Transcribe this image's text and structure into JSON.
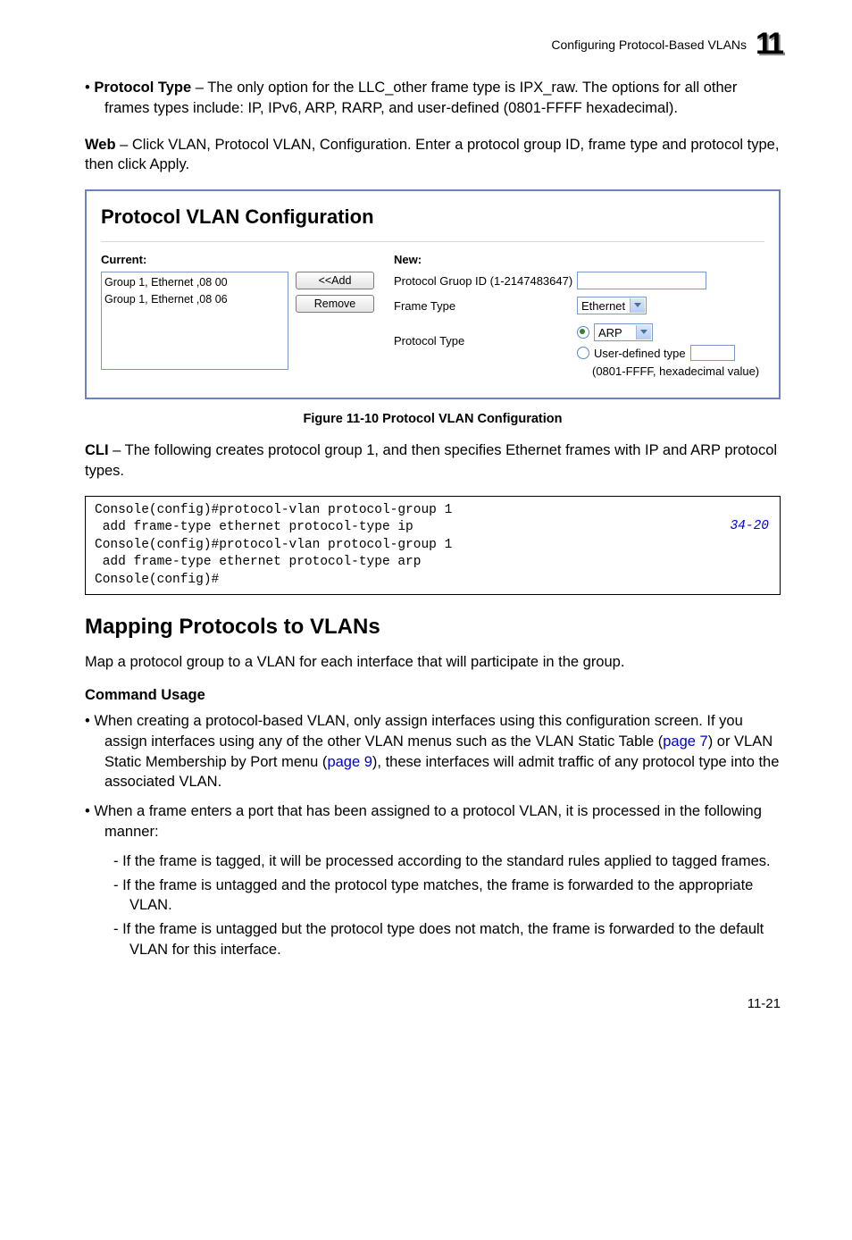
{
  "header": {
    "breadcrumb": "Configuring Protocol-Based VLANs",
    "chapter": "11"
  },
  "intro_bullet": {
    "label": "Protocol Type",
    "text": " – The only option for the LLC_other frame type is IPX_raw. The options for all other frames types include: IP, IPv6, ARP, RARP, and user-defined (0801-FFFF hexadecimal)."
  },
  "web_para": {
    "lead": "Web",
    "text": " – Click VLAN, Protocol VLAN, Configuration. Enter a protocol group ID, frame type and protocol type, then click Apply."
  },
  "shot": {
    "title": "Protocol VLAN Configuration",
    "current_label": "Current:",
    "new_label": "New:",
    "list_items": [
      "Group 1, Ethernet ,08 00",
      "Group 1, Ethernet ,08 06"
    ],
    "add_btn": "<<Add",
    "remove_btn": "Remove",
    "fields": {
      "group_id": "Protocol Gruop ID (1-2147483647)",
      "frame_type": "Frame Type",
      "frame_type_value": "Ethernet",
      "protocol_type": "Protocol Type",
      "proto_opt1": "ARP",
      "proto_opt2_a": "User-defined type",
      "proto_opt2_b": "(0801-FFFF, hexadecimal value)"
    }
  },
  "figure_caption": "Figure 11-10   Protocol VLAN Configuration",
  "cli_para": {
    "lead": "CLI",
    "text": " – The following creates protocol group 1, and then specifies Ethernet frames with IP and ARP protocol types."
  },
  "code": {
    "lines": "Console(config)#protocol-vlan protocol-group 1\n add frame-type ethernet protocol-type ip\nConsole(config)#protocol-vlan protocol-group 1\n add frame-type ethernet protocol-type arp\nConsole(config)#",
    "ref": "34-20"
  },
  "section_heading": "Mapping Protocols to VLANs",
  "section_intro": "Map a protocol group to a VLAN for each interface that will participate in the group.",
  "command_usage": "Command Usage",
  "usage_bullets": {
    "b1a": "When creating a protocol-based VLAN, only assign interfaces using this configuration screen. If you assign interfaces using any of the other VLAN menus such as the VLAN Static Table (",
    "b1link1": "page 7",
    "b1b": ") or VLAN Static Membership by Port menu (",
    "b1link2": "page 9",
    "b1c": "), these interfaces will admit traffic of any protocol type into the associated VLAN.",
    "b2": "When a frame enters a port that has been assigned to a protocol VLAN, it is processed in the following manner:",
    "sub1": "If the frame is tagged, it will be processed according to the standard rules applied to tagged frames.",
    "sub2": "If the frame is untagged and the protocol type matches, the frame is forwarded to the appropriate VLAN.",
    "sub3": "If the frame is untagged but the protocol type does not match, the frame is forwarded to the default VLAN for this interface."
  },
  "page_number": "11-21"
}
